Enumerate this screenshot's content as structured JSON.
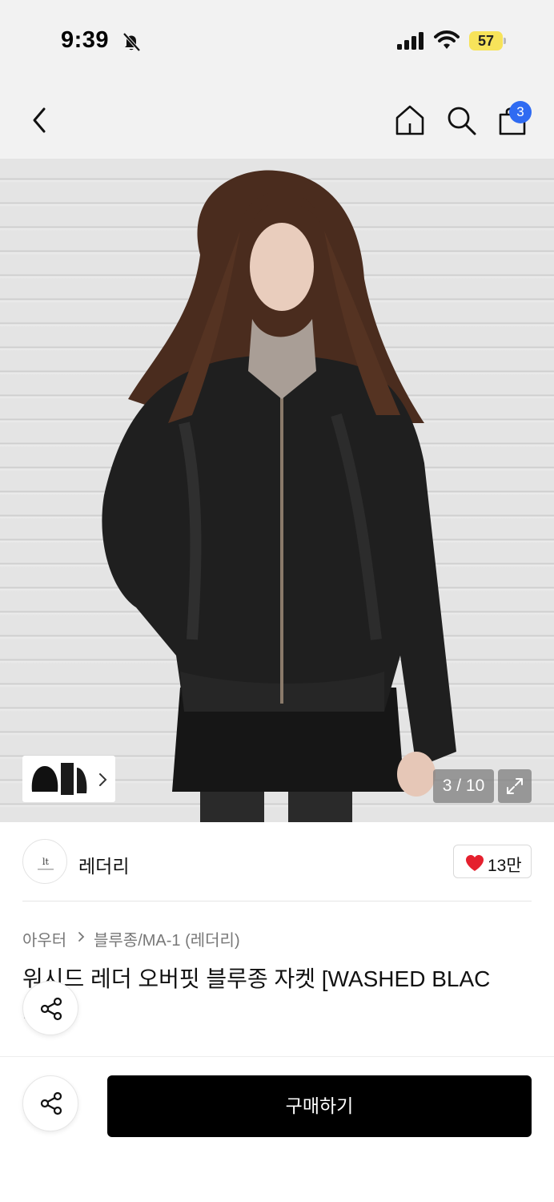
{
  "status_bar": {
    "time": "9:39",
    "battery_level": "57",
    "battery_color": "#f7e35a",
    "icons": [
      "bell-slash-icon",
      "cellular-signal-icon",
      "wifi-icon",
      "battery-icon"
    ]
  },
  "nav": {
    "icons": [
      "chevron-left-icon",
      "home-icon",
      "search-icon",
      "shopping-bag-icon"
    ],
    "cart_count": "3",
    "badge_color": "#2f6bf2"
  },
  "gallery": {
    "counter": "3 / 10",
    "current_index": 3,
    "total_images": 10,
    "icons": [
      "chevron-right-icon",
      "expand-icon"
    ]
  },
  "brand": {
    "name": "레더리",
    "likes": "13만",
    "heart_color": "#e5202e"
  },
  "breadcrumb": {
    "category": "아우터",
    "subcategory": "블루종/MA-1 (레더리)"
  },
  "product": {
    "title": "워시드 레더 오버핏 블루종 자켓 [WASHED BLAC",
    "title_line2": "K]"
  },
  "bottom": {
    "buy_label": "구매하기",
    "icons": [
      "share-icon"
    ]
  }
}
